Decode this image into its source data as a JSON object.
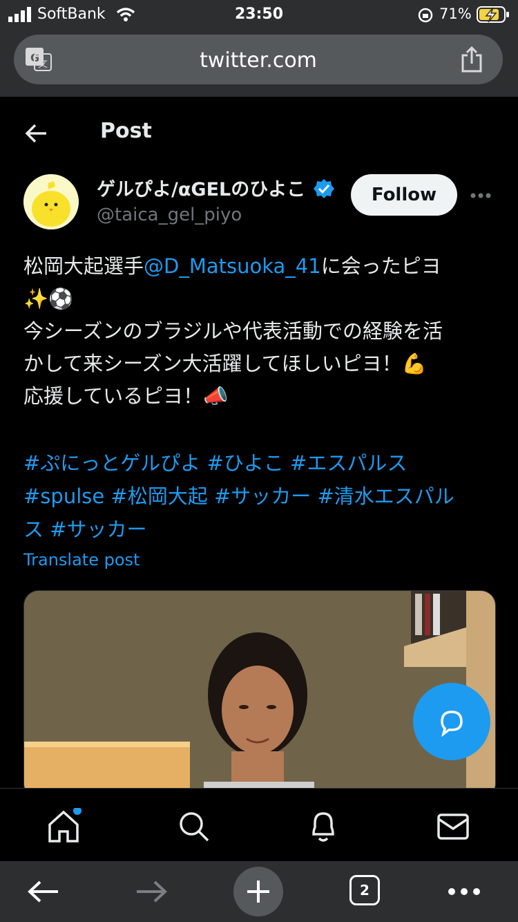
{
  "status_bar": {
    "carrier": "SoftBank",
    "time": "23:50",
    "battery": "71%"
  },
  "browser": {
    "url": "twitter.com",
    "tab_count": "2"
  },
  "header": {
    "title": "Post"
  },
  "author": {
    "name": "ゲルぴよ/αGELのひよこ",
    "handle": "@taica_gel_piyo",
    "follow_label": "Follow"
  },
  "tweet": {
    "line1_prefix": "松岡大起選手",
    "mention": "@D_Matsuoka_41",
    "line1_suffix": "に会ったピヨ",
    "emoji_line": "✨⚽",
    "line3": "今シーズンのブラジルや代表活動での経験を活",
    "line4": "かして来シーズン大活躍してほしいピヨ！💪",
    "line5": "応援しているピヨ！📣"
  },
  "hashtags": {
    "line1": "#ぷにっとゲルぴよ #ひよこ #エスパルス",
    "line2": "#spulse #松岡大起 #サッカー #清水エスパル",
    "line3": "ス #サッカー"
  },
  "translate_label": "Translate post",
  "colors": {
    "accent": "#1d9bf0",
    "background": "#000000",
    "text": "#e7e9ea",
    "muted": "#71767b"
  },
  "icons": [
    "translate-icon",
    "share-icon",
    "back-arrow-icon",
    "verified-badge-icon",
    "more-icon",
    "compose-reply-icon",
    "home-icon",
    "search-icon",
    "bell-icon",
    "mail-icon",
    "browser-back-icon",
    "browser-forward-icon",
    "new-tab-icon",
    "tabs-icon",
    "browser-menu-icon"
  ]
}
